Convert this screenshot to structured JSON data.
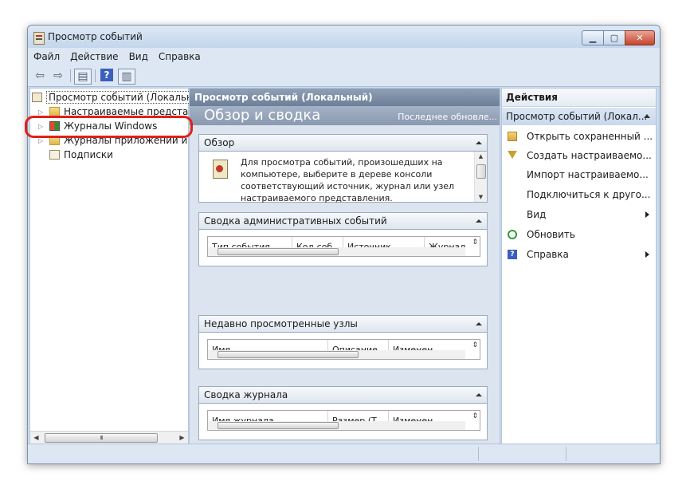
{
  "window": {
    "title": "Просмотр событий"
  },
  "menu": [
    "Файл",
    "Действие",
    "Вид",
    "Справка"
  ],
  "tree": {
    "root": "Просмотр событий (Локальный)",
    "items": [
      {
        "label": "Настраиваемые представления",
        "icon": "folder-icon"
      },
      {
        "label": "Журналы Windows",
        "icon": "windows-logs-icon",
        "highlighted": true
      },
      {
        "label": "Журналы приложений и служб",
        "icon": "folder-icon"
      },
      {
        "label": "Подписки",
        "icon": "subscriptions-icon"
      }
    ]
  },
  "middle": {
    "header": "Просмотр событий (Локальный)",
    "overview_title": "Обзор и сводка",
    "last_updated": "Последнее обновле...",
    "sections": {
      "overview": {
        "title": "Обзор",
        "text": "Для просмотра событий, произошедших на компьютере, выберите в дереве консоли соответствующий источник, журнал или узел настраиваемого представления. Настраиваемое"
      },
      "admin_summary": {
        "title": "Сводка административных событий",
        "columns": [
          "Тип события",
          "Код соб...",
          "Источник",
          "Журнал"
        ]
      },
      "recent_nodes": {
        "title": "Недавно просмотренные узлы",
        "columns": [
          "Имя",
          "Описание",
          "Изменен"
        ]
      },
      "log_summary": {
        "title": "Сводка журнала",
        "columns": [
          "Имя журнала",
          "Размер (Т...",
          "Изменен"
        ]
      }
    }
  },
  "actions": {
    "header": "Действия",
    "subheader": "Просмотр событий (Локал...",
    "items": [
      {
        "label": "Открыть сохраненный ...",
        "icon": "open-folder-icon"
      },
      {
        "label": "Создать настраиваемо...",
        "icon": "filter-icon"
      },
      {
        "label": "Импорт настраиваемо...",
        "icon": ""
      },
      {
        "label": "Подключиться к друго...",
        "icon": ""
      },
      {
        "label": "Вид",
        "icon": "",
        "submenu": true
      },
      {
        "label": "Обновить",
        "icon": "refresh-icon"
      },
      {
        "label": "Справка",
        "icon": "help-icon",
        "submenu": true
      }
    ]
  },
  "colors": {
    "highlight_ring": "#e0201a",
    "accent": "#3a5fbf"
  }
}
